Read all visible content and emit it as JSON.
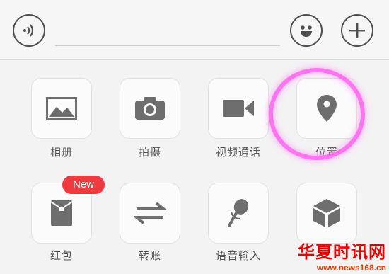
{
  "toolbar": {
    "voice_icon": "voice-icon",
    "emoji_icon": "emoji-icon",
    "plus_icon": "plus-icon"
  },
  "panel": {
    "items": [
      {
        "label": "相册",
        "icon": "image-icon"
      },
      {
        "label": "拍摄",
        "icon": "camera-icon"
      },
      {
        "label": "视频通话",
        "icon": "video-camera-icon"
      },
      {
        "label": "位置",
        "icon": "location-pin-icon"
      },
      {
        "label": "红包",
        "icon": "red-packet-icon",
        "badge": "New"
      },
      {
        "label": "转账",
        "icon": "transfer-icon"
      },
      {
        "label": "语音输入",
        "icon": "microphone-icon"
      },
      {
        "label": "",
        "icon": "box-icon"
      }
    ]
  },
  "watermark": {
    "title": "华夏时讯网",
    "url": "www.news168.cn"
  },
  "colors": {
    "badge": "#ee3b3f",
    "highlight": "#ff5ff0",
    "icon": "#6e6e6e"
  }
}
